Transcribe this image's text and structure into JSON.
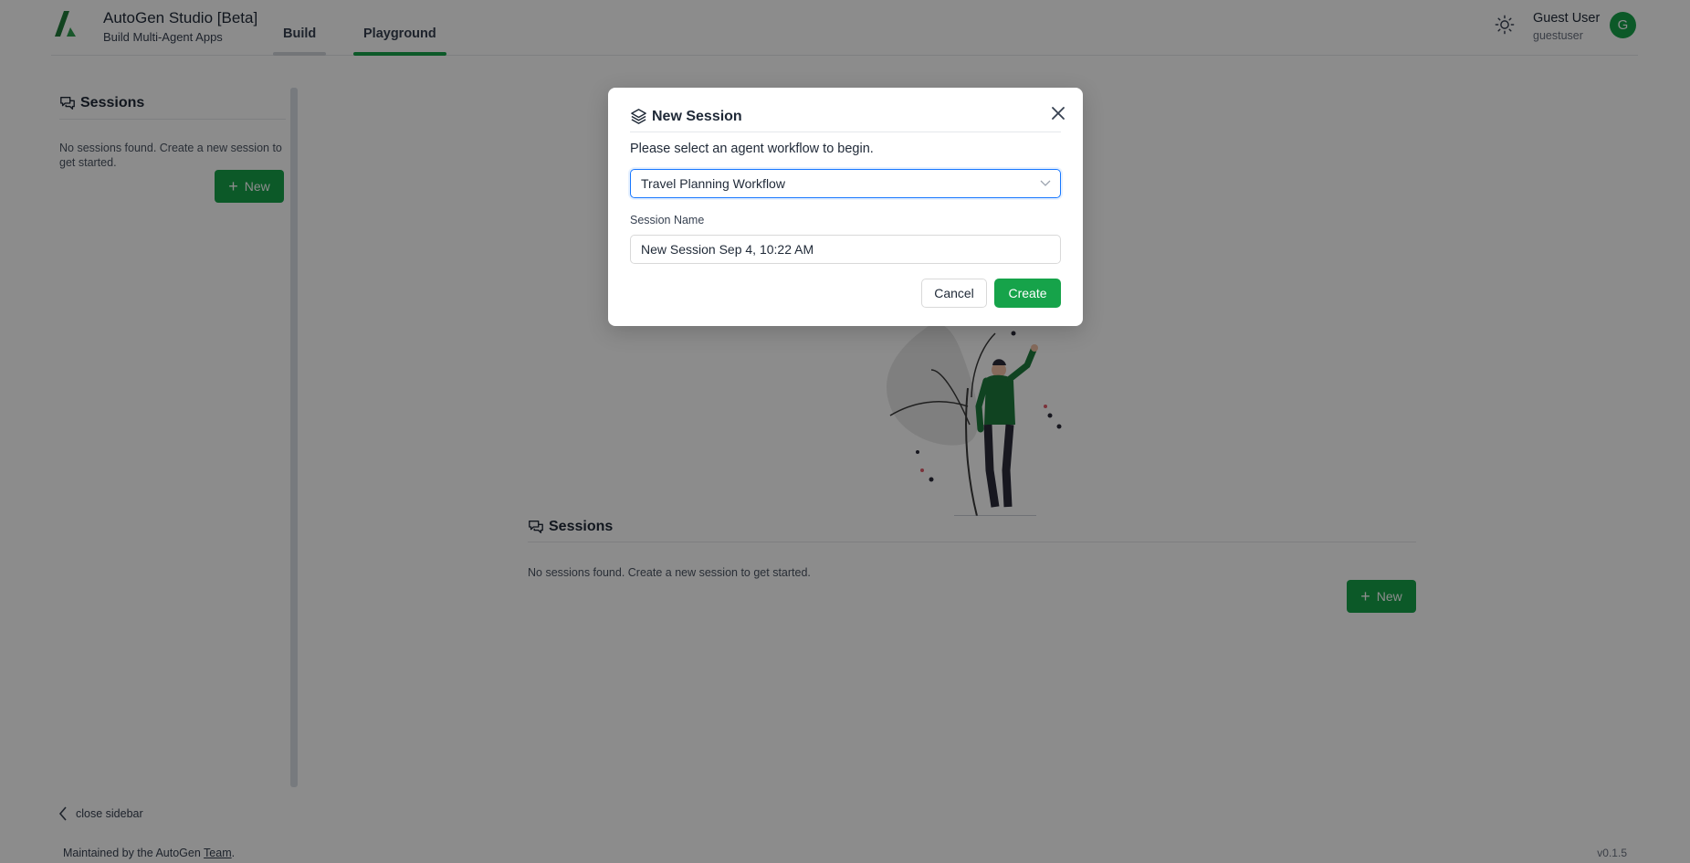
{
  "header": {
    "app_title": "AutoGen Studio [Beta]",
    "app_subtitle": "Build Multi-Agent Apps",
    "tabs": [
      {
        "label": "Build",
        "active": false
      },
      {
        "label": "Playground",
        "active": true
      }
    ],
    "user": {
      "name": "Guest User",
      "handle": "guestuser",
      "avatar_initial": "G"
    },
    "theme_icon": "sun-icon"
  },
  "sidebar": {
    "title": "Sessions",
    "empty_message": "No sessions found. Create a new session to get started.",
    "new_button_label": "New",
    "close_label": "close sidebar"
  },
  "main": {
    "sessions_title": "Sessions",
    "empty_message": "No sessions found. Create a new session to get started.",
    "new_button_label": "New"
  },
  "modal": {
    "title": "New Session",
    "prompt": "Please select an agent workflow to begin.",
    "workflow_selected": "Travel Planning Workflow",
    "session_name_label": "Session Name",
    "session_name_value": "New Session Sep 4, 10:22 AM",
    "cancel_label": "Cancel",
    "create_label": "Create"
  },
  "footer": {
    "maintained_prefix": "Maintained by the AutoGen ",
    "team_link": "Team",
    "maintained_suffix": ".",
    "version": "v0.1.5"
  },
  "colors": {
    "accent_green": "#16a34a",
    "focus_blue": "#1677ff",
    "overlay": "rgba(0,0,0,0.45)"
  }
}
